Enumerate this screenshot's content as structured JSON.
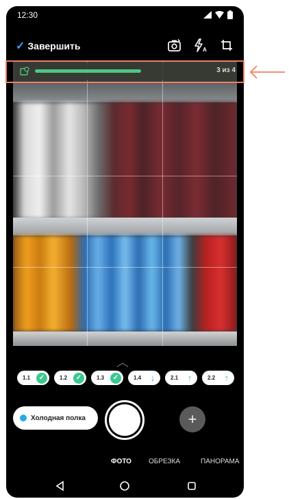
{
  "status_bar": {
    "time": "12:30"
  },
  "header": {
    "finish_label": "Завершить"
  },
  "progress": {
    "label": "3 из 4",
    "fraction": 0.75
  },
  "chips": [
    {
      "label": "1.1",
      "state": "done"
    },
    {
      "label": "1.2",
      "state": "done"
    },
    {
      "label": "1.3",
      "state": "done"
    },
    {
      "label": "1.4",
      "state": "down"
    },
    {
      "label": "2.1",
      "state": "up"
    },
    {
      "label": "2.2",
      "state": "up"
    }
  ],
  "shelf_type": {
    "label": "Холодная полка",
    "color": "#2aa8e8"
  },
  "modes": [
    {
      "label": "ФОТО",
      "active": true
    },
    {
      "label": "ОБРЕЗКА",
      "active": false
    },
    {
      "label": "ПАНОРАМА",
      "active": false
    }
  ],
  "colors": {
    "accent_green": "#4cc783",
    "accent_blue": "#3aa0ff",
    "highlight": "#f08060"
  }
}
